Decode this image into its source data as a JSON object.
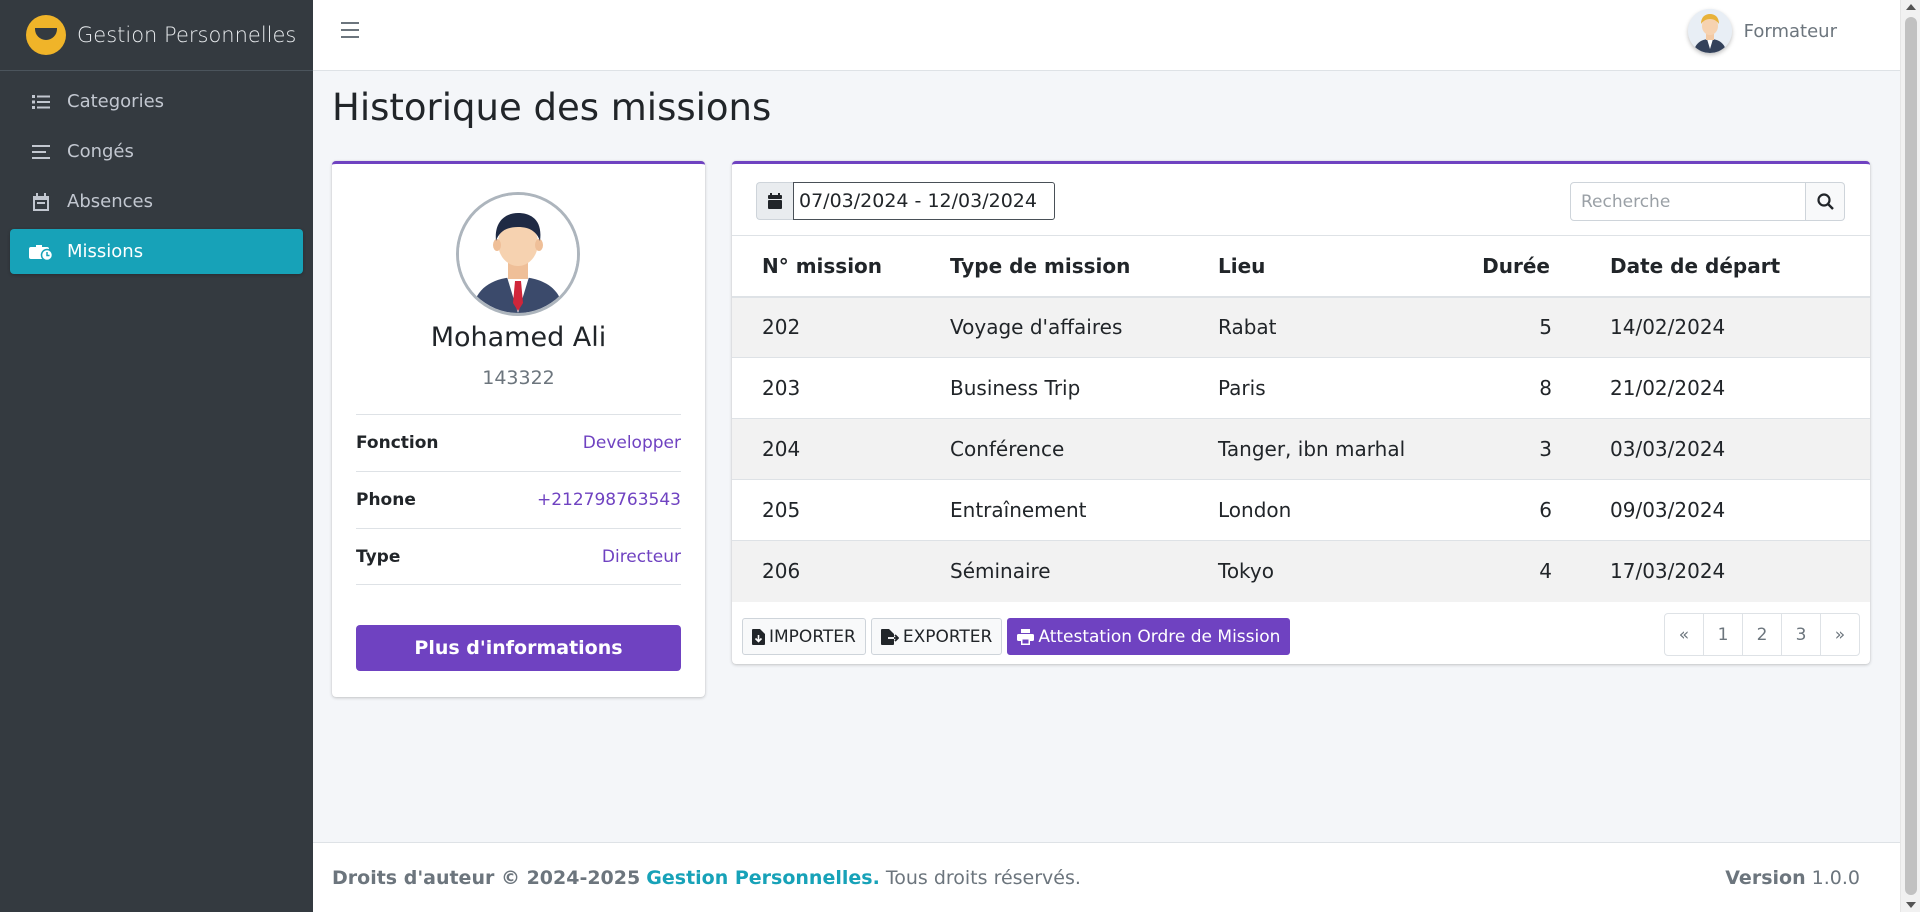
{
  "app": {
    "brand": "Gestion Personnelles"
  },
  "sidebar": {
    "items": [
      {
        "label": "Categories",
        "icon": "list-icon"
      },
      {
        "label": "Congés",
        "icon": "bars-icon"
      },
      {
        "label": "Absences",
        "icon": "calendar-icon"
      },
      {
        "label": "Missions",
        "icon": "briefcase-clock-icon",
        "active": true
      }
    ]
  },
  "header": {
    "user": "Formateur"
  },
  "page": {
    "title": "Historique des missions"
  },
  "profile": {
    "name": "Mohamed Ali",
    "id": "143322",
    "fields": [
      {
        "key": "Fonction",
        "value": "Developper"
      },
      {
        "key": "Phone",
        "value": "+212798763543"
      },
      {
        "key": "Type",
        "value": "Directeur"
      }
    ],
    "more_button": "Plus d'informations"
  },
  "filters": {
    "date_range": "07/03/2024 - 12/03/2024",
    "search_placeholder": "Recherche"
  },
  "table": {
    "columns": [
      "N° mission",
      "Type de mission",
      "Lieu",
      "Durée",
      "Date de départ"
    ],
    "rows": [
      [
        "202",
        "Voyage d'affaires",
        "Rabat",
        "5",
        "14/02/2024"
      ],
      [
        "203",
        "Business Trip",
        "Paris",
        "8",
        "21/02/2024"
      ],
      [
        "204",
        "Conférence",
        "Tanger, ibn marhal",
        "3",
        "03/03/2024"
      ],
      [
        "205",
        "Entraînement",
        "London",
        "6",
        "09/03/2024"
      ],
      [
        "206",
        "Séminaire",
        "Tokyo",
        "4",
        "17/03/2024"
      ]
    ]
  },
  "actions": {
    "import": "IMPORTER",
    "export": "EXPORTER",
    "attestation": "Attestation Ordre de Mission"
  },
  "pagination": [
    "«",
    "1",
    "2",
    "3",
    "»"
  ],
  "footer": {
    "copyright": "Droits d'auteur © 2024-2025",
    "brand": "Gestion Personnelles.",
    "rights": "Tous droits réservés.",
    "version_label": "Version",
    "version": "1.0.0"
  },
  "colors": {
    "accent": "#6f42c1",
    "active": "#17a2b8",
    "sidebar": "#343a40"
  }
}
